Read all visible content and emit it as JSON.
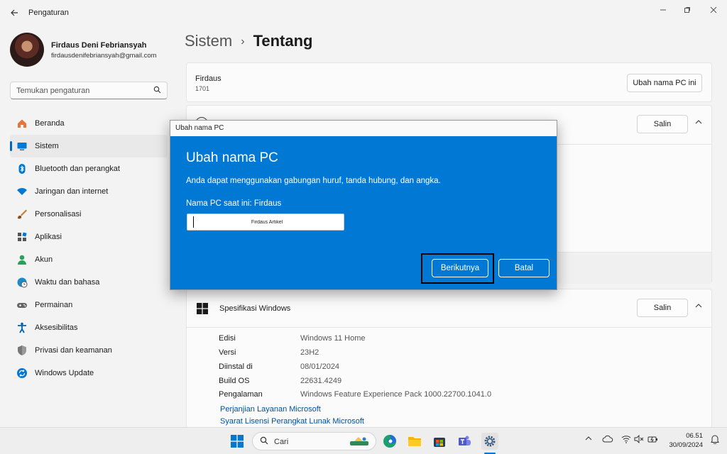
{
  "app": {
    "title": "Pengaturan"
  },
  "profile": {
    "name": "Firdaus Deni Febriansyah",
    "email": "firdausdenifebriansyah@gmail.com"
  },
  "search": {
    "placeholder": "Temukan pengaturan"
  },
  "nav": [
    {
      "label": "Beranda",
      "icon": "home-icon",
      "color": "#e8743b"
    },
    {
      "label": "Sistem",
      "icon": "system-icon",
      "color": "#0078d4",
      "active": true
    },
    {
      "label": "Bluetooth dan perangkat",
      "icon": "bluetooth-icon",
      "color": "#0078d4"
    },
    {
      "label": "Jaringan dan internet",
      "icon": "wifi-icon",
      "color": "#0078d4"
    },
    {
      "label": "Personalisasi",
      "icon": "brush-icon",
      "color": "#c47a3a"
    },
    {
      "label": "Aplikasi",
      "icon": "apps-icon",
      "color": "#555555"
    },
    {
      "label": "Akun",
      "icon": "account-icon",
      "color": "#2d9f5c"
    },
    {
      "label": "Waktu dan bahasa",
      "icon": "globe-clock-icon",
      "color": "#1e88c8"
    },
    {
      "label": "Permainan",
      "icon": "gamepad-icon",
      "color": "#666666"
    },
    {
      "label": "Aksesibilitas",
      "icon": "accessibility-icon",
      "color": "#0060b0"
    },
    {
      "label": "Privasi dan keamanan",
      "icon": "shield-icon",
      "color": "#777777"
    },
    {
      "label": "Windows Update",
      "icon": "update-icon",
      "color": "#0078d4"
    }
  ],
  "breadcrumb": {
    "parent": "Sistem",
    "current": "Tentang"
  },
  "device_card": {
    "name": "Firdaus",
    "model": "1701",
    "rename_button": "Ubah nama PC ini"
  },
  "device_spec_card": {
    "copy_button": "Salin"
  },
  "windows_spec": {
    "title": "Spesifikasi Windows",
    "copy_button": "Salin",
    "rows": [
      {
        "label": "Edisi",
        "value": "Windows 11 Home"
      },
      {
        "label": "Versi",
        "value": "23H2"
      },
      {
        "label": "Diinstal di",
        "value": "08/01/2024"
      },
      {
        "label": "Build OS",
        "value": "22631.4249"
      },
      {
        "label": "Pengalaman",
        "value": "Windows Feature Experience Pack 1000.22700.1041.0"
      }
    ],
    "links": [
      "Perjanjian Layanan Microsoft",
      "Syarat Lisensi Perangkat Lunak Microsoft"
    ]
  },
  "dialog": {
    "window_title": "Ubah nama PC",
    "heading": "Ubah nama PC",
    "description": "Anda dapat menggunakan gabungan huruf, tanda hubung, dan angka.",
    "current_name": "Nama PC saat ini: Firdaus",
    "input_value": "Firdaus Artikel",
    "next_button": "Berikutnya",
    "cancel_button": "Batal"
  },
  "taskbar": {
    "search_label": "Cari",
    "time": "06.51",
    "date": "30/09/2024"
  }
}
